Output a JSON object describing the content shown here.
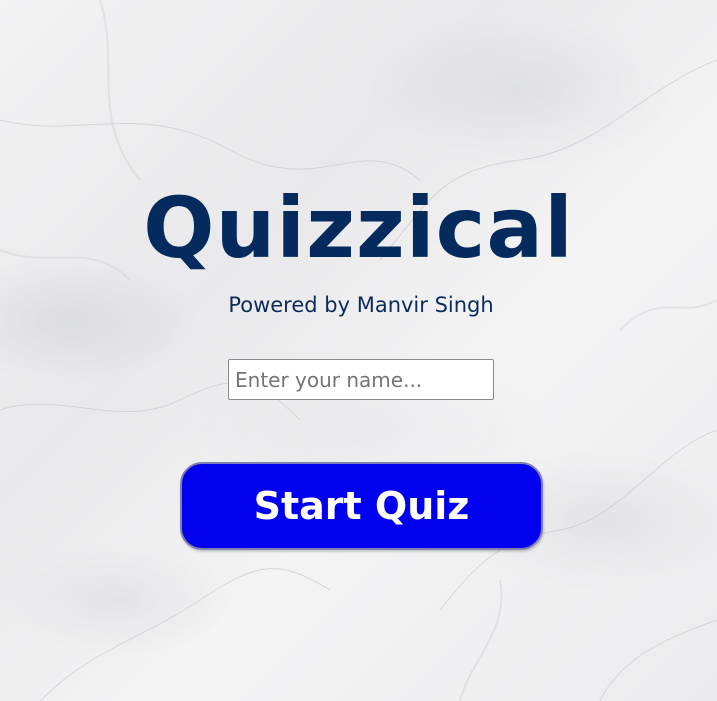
{
  "app": {
    "title": "Quizzical",
    "subtitle": "Powered by Manvir Singh"
  },
  "form": {
    "name_placeholder": "Enter your name...",
    "name_value": "",
    "start_label": "Start Quiz"
  },
  "colors": {
    "title": "#052a5e",
    "button_background": "#0000ee",
    "button_text": "#ffffff",
    "page_background": "#f0f0f1"
  }
}
